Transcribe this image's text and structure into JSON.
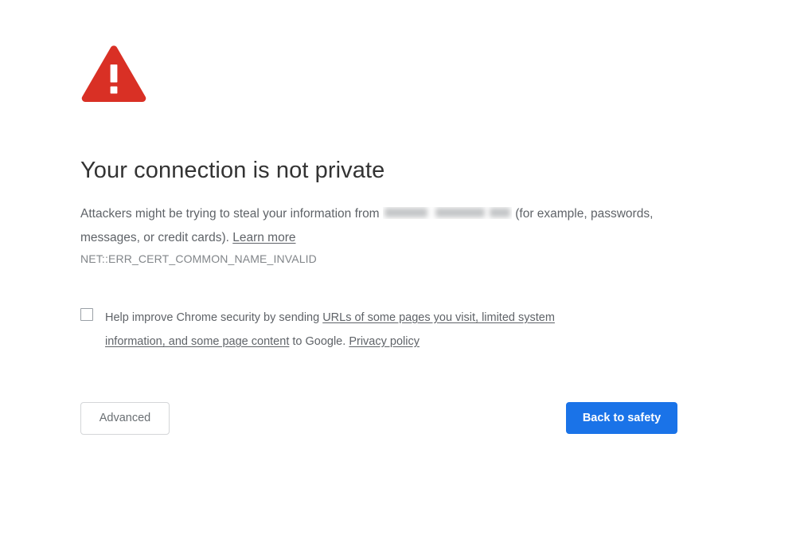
{
  "page": {
    "background": "#ffffff"
  },
  "icon": {
    "name": "warning-triangle-icon",
    "color": "#d93025",
    "mark_color": "#ffffff"
  },
  "heading": "Your connection is not private",
  "body": {
    "lead": "Attackers might be trying to steal your information from",
    "redacted_domain": "",
    "middle": " (for example, passwords, messages, or credit cards). ",
    "learn_more_label": "Learn more"
  },
  "error_code": "NET::ERR_CERT_COMMON_NAME_INVALID",
  "optin": {
    "checked": false,
    "text_before": "Help improve Chrome security by sending ",
    "link_one": "URLs of some pages you visit, limited system information, and some page content",
    "text_middle": " to Google. ",
    "link_two": "Privacy policy"
  },
  "buttons": {
    "advanced_label": "Advanced",
    "safety_label": "Back to safety",
    "safety_color": "#1a73e8"
  }
}
